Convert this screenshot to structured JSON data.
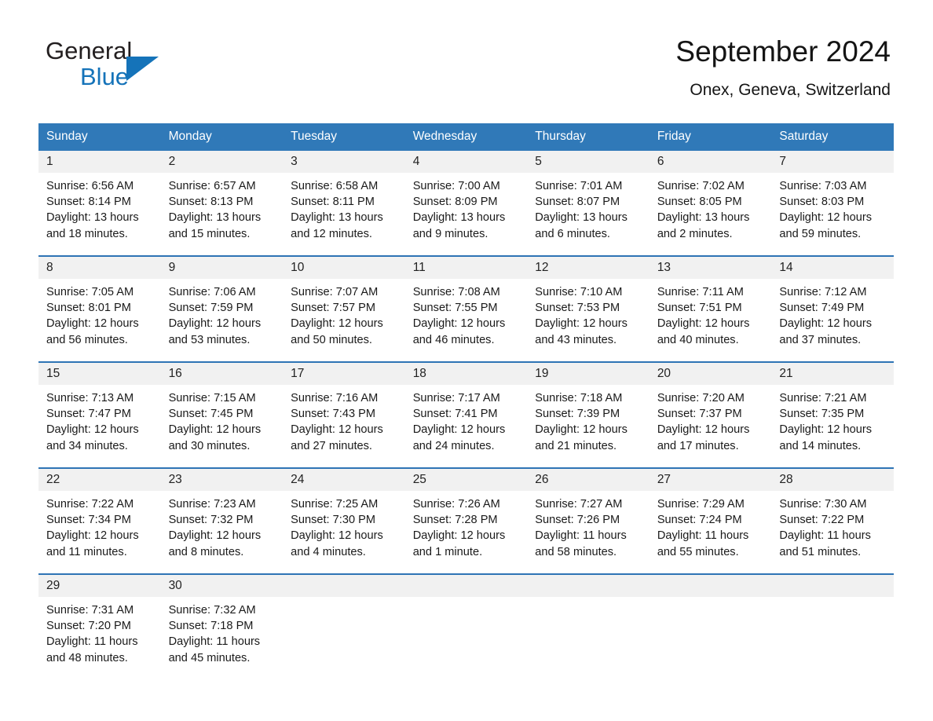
{
  "brand": {
    "logo_line1": "General",
    "logo_line2": "Blue",
    "logo_icon": "triangle-icon",
    "color_dark": "#231f20",
    "color_blue": "#1573b9"
  },
  "header": {
    "title": "September 2024",
    "subtitle": "Onex, Geneva, Switzerland"
  },
  "theme": {
    "header_row_bg": "#3079b8",
    "header_row_text": "#ffffff",
    "row_divider": "#2e74b5",
    "daynum_bg": "#f1f1f1",
    "page_bg": "#ffffff"
  },
  "calendar": {
    "weekday_headers": [
      "Sunday",
      "Monday",
      "Tuesday",
      "Wednesday",
      "Thursday",
      "Friday",
      "Saturday"
    ],
    "weeks": [
      [
        {
          "day": "1",
          "sunrise": "Sunrise: 6:56 AM",
          "sunset": "Sunset: 8:14 PM",
          "daylight": "Daylight: 13 hours and 18 minutes."
        },
        {
          "day": "2",
          "sunrise": "Sunrise: 6:57 AM",
          "sunset": "Sunset: 8:13 PM",
          "daylight": "Daylight: 13 hours and 15 minutes."
        },
        {
          "day": "3",
          "sunrise": "Sunrise: 6:58 AM",
          "sunset": "Sunset: 8:11 PM",
          "daylight": "Daylight: 13 hours and 12 minutes."
        },
        {
          "day": "4",
          "sunrise": "Sunrise: 7:00 AM",
          "sunset": "Sunset: 8:09 PM",
          "daylight": "Daylight: 13 hours and 9 minutes."
        },
        {
          "day": "5",
          "sunrise": "Sunrise: 7:01 AM",
          "sunset": "Sunset: 8:07 PM",
          "daylight": "Daylight: 13 hours and 6 minutes."
        },
        {
          "day": "6",
          "sunrise": "Sunrise: 7:02 AM",
          "sunset": "Sunset: 8:05 PM",
          "daylight": "Daylight: 13 hours and 2 minutes."
        },
        {
          "day": "7",
          "sunrise": "Sunrise: 7:03 AM",
          "sunset": "Sunset: 8:03 PM",
          "daylight": "Daylight: 12 hours and 59 minutes."
        }
      ],
      [
        {
          "day": "8",
          "sunrise": "Sunrise: 7:05 AM",
          "sunset": "Sunset: 8:01 PM",
          "daylight": "Daylight: 12 hours and 56 minutes."
        },
        {
          "day": "9",
          "sunrise": "Sunrise: 7:06 AM",
          "sunset": "Sunset: 7:59 PM",
          "daylight": "Daylight: 12 hours and 53 minutes."
        },
        {
          "day": "10",
          "sunrise": "Sunrise: 7:07 AM",
          "sunset": "Sunset: 7:57 PM",
          "daylight": "Daylight: 12 hours and 50 minutes."
        },
        {
          "day": "11",
          "sunrise": "Sunrise: 7:08 AM",
          "sunset": "Sunset: 7:55 PM",
          "daylight": "Daylight: 12 hours and 46 minutes."
        },
        {
          "day": "12",
          "sunrise": "Sunrise: 7:10 AM",
          "sunset": "Sunset: 7:53 PM",
          "daylight": "Daylight: 12 hours and 43 minutes."
        },
        {
          "day": "13",
          "sunrise": "Sunrise: 7:11 AM",
          "sunset": "Sunset: 7:51 PM",
          "daylight": "Daylight: 12 hours and 40 minutes."
        },
        {
          "day": "14",
          "sunrise": "Sunrise: 7:12 AM",
          "sunset": "Sunset: 7:49 PM",
          "daylight": "Daylight: 12 hours and 37 minutes."
        }
      ],
      [
        {
          "day": "15",
          "sunrise": "Sunrise: 7:13 AM",
          "sunset": "Sunset: 7:47 PM",
          "daylight": "Daylight: 12 hours and 34 minutes."
        },
        {
          "day": "16",
          "sunrise": "Sunrise: 7:15 AM",
          "sunset": "Sunset: 7:45 PM",
          "daylight": "Daylight: 12 hours and 30 minutes."
        },
        {
          "day": "17",
          "sunrise": "Sunrise: 7:16 AM",
          "sunset": "Sunset: 7:43 PM",
          "daylight": "Daylight: 12 hours and 27 minutes."
        },
        {
          "day": "18",
          "sunrise": "Sunrise: 7:17 AM",
          "sunset": "Sunset: 7:41 PM",
          "daylight": "Daylight: 12 hours and 24 minutes."
        },
        {
          "day": "19",
          "sunrise": "Sunrise: 7:18 AM",
          "sunset": "Sunset: 7:39 PM",
          "daylight": "Daylight: 12 hours and 21 minutes."
        },
        {
          "day": "20",
          "sunrise": "Sunrise: 7:20 AM",
          "sunset": "Sunset: 7:37 PM",
          "daylight": "Daylight: 12 hours and 17 minutes."
        },
        {
          "day": "21",
          "sunrise": "Sunrise: 7:21 AM",
          "sunset": "Sunset: 7:35 PM",
          "daylight": "Daylight: 12 hours and 14 minutes."
        }
      ],
      [
        {
          "day": "22",
          "sunrise": "Sunrise: 7:22 AM",
          "sunset": "Sunset: 7:34 PM",
          "daylight": "Daylight: 12 hours and 11 minutes."
        },
        {
          "day": "23",
          "sunrise": "Sunrise: 7:23 AM",
          "sunset": "Sunset: 7:32 PM",
          "daylight": "Daylight: 12 hours and 8 minutes."
        },
        {
          "day": "24",
          "sunrise": "Sunrise: 7:25 AM",
          "sunset": "Sunset: 7:30 PM",
          "daylight": "Daylight: 12 hours and 4 minutes."
        },
        {
          "day": "25",
          "sunrise": "Sunrise: 7:26 AM",
          "sunset": "Sunset: 7:28 PM",
          "daylight": "Daylight: 12 hours and 1 minute."
        },
        {
          "day": "26",
          "sunrise": "Sunrise: 7:27 AM",
          "sunset": "Sunset: 7:26 PM",
          "daylight": "Daylight: 11 hours and 58 minutes."
        },
        {
          "day": "27",
          "sunrise": "Sunrise: 7:29 AM",
          "sunset": "Sunset: 7:24 PM",
          "daylight": "Daylight: 11 hours and 55 minutes."
        },
        {
          "day": "28",
          "sunrise": "Sunrise: 7:30 AM",
          "sunset": "Sunset: 7:22 PM",
          "daylight": "Daylight: 11 hours and 51 minutes."
        }
      ],
      [
        {
          "day": "29",
          "sunrise": "Sunrise: 7:31 AM",
          "sunset": "Sunset: 7:20 PM",
          "daylight": "Daylight: 11 hours and 48 minutes."
        },
        {
          "day": "30",
          "sunrise": "Sunrise: 7:32 AM",
          "sunset": "Sunset: 7:18 PM",
          "daylight": "Daylight: 11 hours and 45 minutes."
        },
        {
          "day": "",
          "sunrise": "",
          "sunset": "",
          "daylight": ""
        },
        {
          "day": "",
          "sunrise": "",
          "sunset": "",
          "daylight": ""
        },
        {
          "day": "",
          "sunrise": "",
          "sunset": "",
          "daylight": ""
        },
        {
          "day": "",
          "sunrise": "",
          "sunset": "",
          "daylight": ""
        },
        {
          "day": "",
          "sunrise": "",
          "sunset": "",
          "daylight": ""
        }
      ]
    ]
  }
}
